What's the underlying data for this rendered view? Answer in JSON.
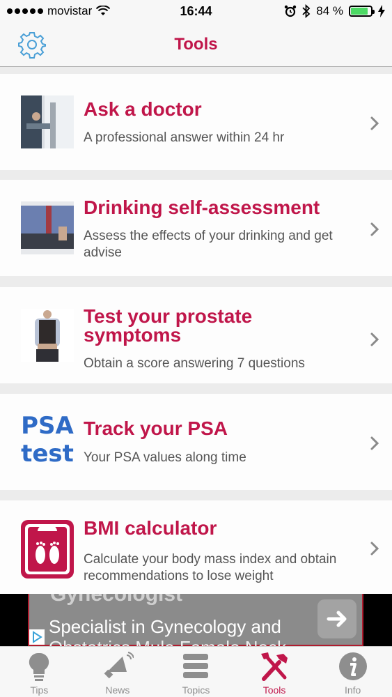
{
  "status_bar": {
    "carrier": "movistar",
    "time": "16:44",
    "battery_percent": "84 %",
    "battery_level": 0.84
  },
  "nav": {
    "title": "Tools",
    "settings_icon": "gear-icon"
  },
  "tools": [
    {
      "title": "Ask a doctor",
      "description": "A professional answer within 24 hr",
      "icon": "doctor-consultation-photo"
    },
    {
      "title": "Drinking self-assessment",
      "description": "Assess the effects of your drinking and get advise",
      "icon": "man-drinking-photo"
    },
    {
      "title": "Test your prostate symptoms",
      "description": "Obtain a score answering 7 questions",
      "icon": "man-standing-photo"
    },
    {
      "title": "Track your PSA",
      "description": "Your PSA values along time",
      "icon": "psa-test-badge",
      "badge_line1": "PSA",
      "badge_line2": "test"
    },
    {
      "title": "BMI calculator",
      "description": "Calculate your body mass index and obtain recommendations to lose weight",
      "icon": "scale-icon"
    }
  ],
  "ad": {
    "heading": "Gynecologist",
    "text_line1": "Specialist in Gynecology and",
    "text_line2": "Obstetrics Mule Female Neck"
  },
  "tab_bar": {
    "items": [
      {
        "label": "Tips",
        "icon": "lightbulb-icon",
        "active": false
      },
      {
        "label": "News",
        "icon": "megaphone-icon",
        "active": false
      },
      {
        "label": "Topics",
        "icon": "list-icon",
        "active": false
      },
      {
        "label": "Tools",
        "icon": "tools-icon",
        "active": true
      },
      {
        "label": "Info",
        "icon": "info-icon",
        "active": false
      }
    ]
  },
  "colors": {
    "accent": "#c0164a",
    "psa_blue": "#2f6bc6",
    "battery_green": "#4cd964"
  }
}
